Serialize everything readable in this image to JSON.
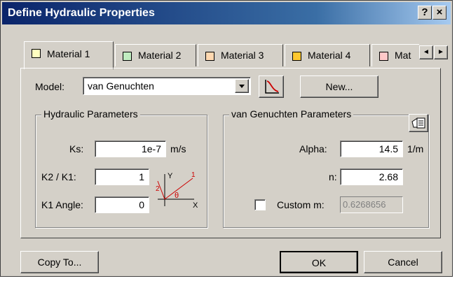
{
  "window": {
    "title": "Define Hydraulic Properties",
    "help_label": "?",
    "close_label": "×"
  },
  "tabs": [
    {
      "label": "Material 1",
      "color": "#ffffc0"
    },
    {
      "label": "Material 2",
      "color": "#c0ecc0"
    },
    {
      "label": "Material 3",
      "color": "#ffd8b0"
    },
    {
      "label": "Material 4",
      "color": "#ffc830"
    },
    {
      "label": "Mat",
      "color": "#ffc8c8"
    }
  ],
  "tab_scroll": {
    "left": "◄",
    "right": "►"
  },
  "model": {
    "label": "Model:",
    "value": "van Genuchten",
    "new_button": "New..."
  },
  "hydraulic": {
    "legend": "Hydraulic Parameters",
    "ks_label": "Ks:",
    "ks_value": "1e-7",
    "ks_unit": "m/s",
    "k2k1_label": "K2 / K1:",
    "k2k1_value": "1",
    "angle_label": "K1 Angle:",
    "angle_value": "0",
    "diagram": {
      "y": "Y",
      "x": "X",
      "one": "1",
      "two": "2",
      "theta": "θ"
    }
  },
  "vg": {
    "legend": "van Genuchten Parameters",
    "alpha_label": "Alpha:",
    "alpha_value": "14.5",
    "alpha_unit": "1/m",
    "n_label": "n:",
    "n_value": "2.68",
    "custom_label": "Custom m:",
    "custom_value": "0.6268656",
    "custom_checked": false
  },
  "footer": {
    "copy_to": "Copy To...",
    "ok": "OK",
    "cancel": "Cancel"
  },
  "colors": {
    "title_start": "#0a246a",
    "face": "#d4d0c8",
    "curve_icon": "#cc0000"
  }
}
